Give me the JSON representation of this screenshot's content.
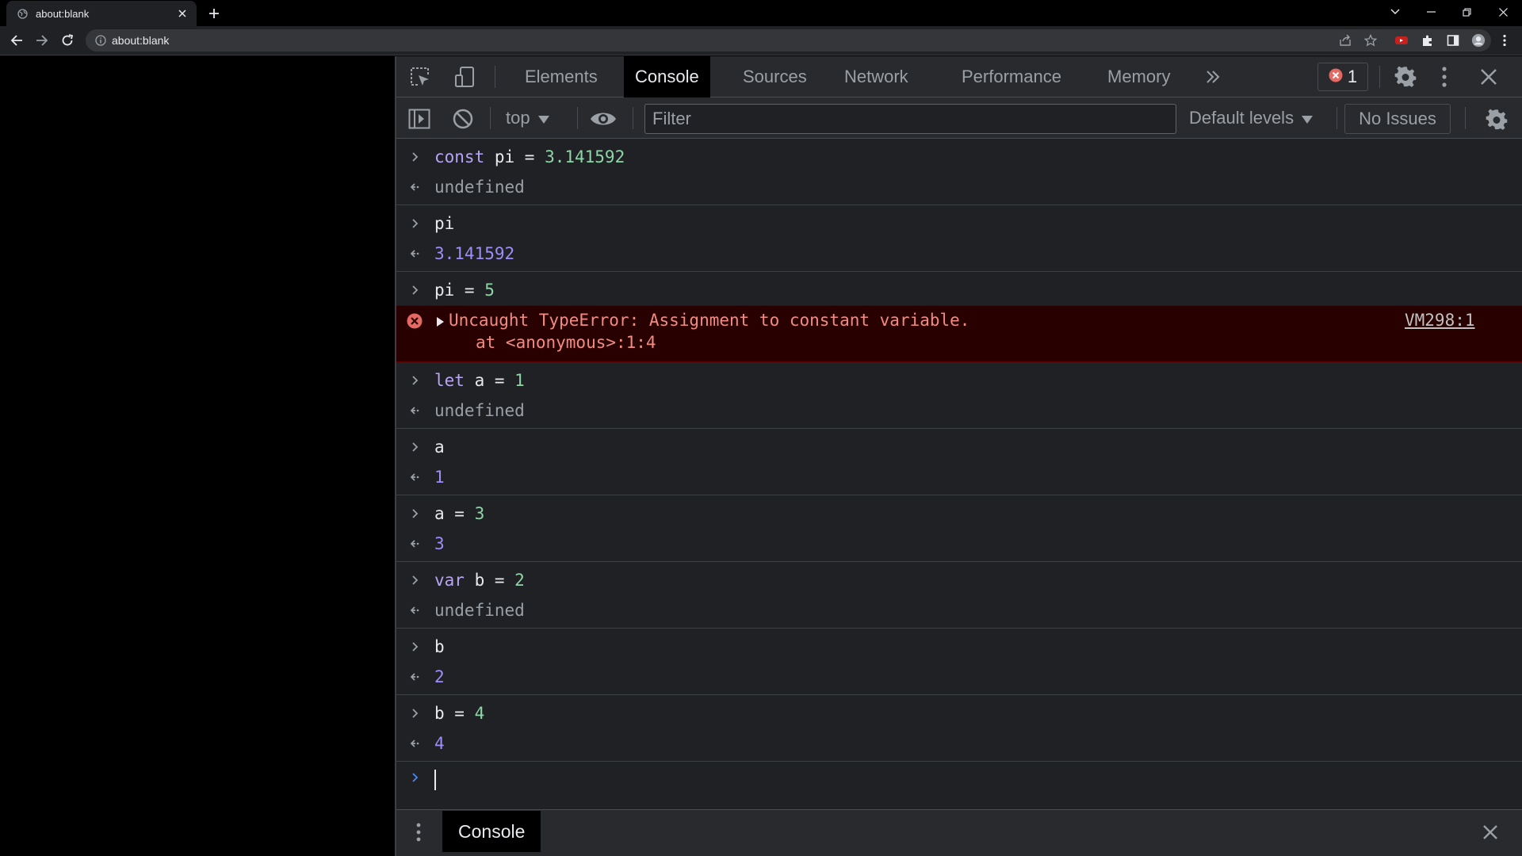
{
  "browser": {
    "tab_title": "about:blank",
    "url": "about:blank"
  },
  "devtools": {
    "tabs": [
      "Elements",
      "Console",
      "Sources",
      "Network",
      "Performance",
      "Memory"
    ],
    "active_tab": "Console",
    "error_count": "1",
    "context": "top",
    "filter_placeholder": "Filter",
    "levels_label": "Default levels",
    "issues_label": "No Issues",
    "drawer_tab": "Console"
  },
  "console": {
    "g1_in_kw": "const",
    "g1_in_rest": " pi = ",
    "g1_in_num": "3.141592",
    "g1_out": "undefined",
    "g2_in": "pi",
    "g2_out": "3.141592",
    "g3_in_rest": "pi = ",
    "g3_in_num": "5",
    "error_msg": "Uncaught TypeError: Assignment to constant variable.",
    "error_trace": "at <anonymous>:1:4",
    "error_src": "VM298:1",
    "g4_in_kw": "let",
    "g4_in_rest": " a = ",
    "g4_in_num": "1",
    "g4_out": "undefined",
    "g5_in": "a",
    "g5_out": "1",
    "g6_in_rest": "a = ",
    "g6_in_num": "3",
    "g6_out": "3",
    "g7_in_kw": "var",
    "g7_in_rest": " b = ",
    "g7_in_num": "2",
    "g7_out": "undefined",
    "g8_in": "b",
    "g8_out": "2",
    "g9_in_rest": "b = ",
    "g9_in_num": "4",
    "g9_out": "4"
  },
  "colors": {
    "error_bg": "#290000",
    "error_text": "#f28b82",
    "keyword": "#b8a5f5",
    "number_input": "#8ed6a7",
    "number_result": "#9f8ef7"
  }
}
